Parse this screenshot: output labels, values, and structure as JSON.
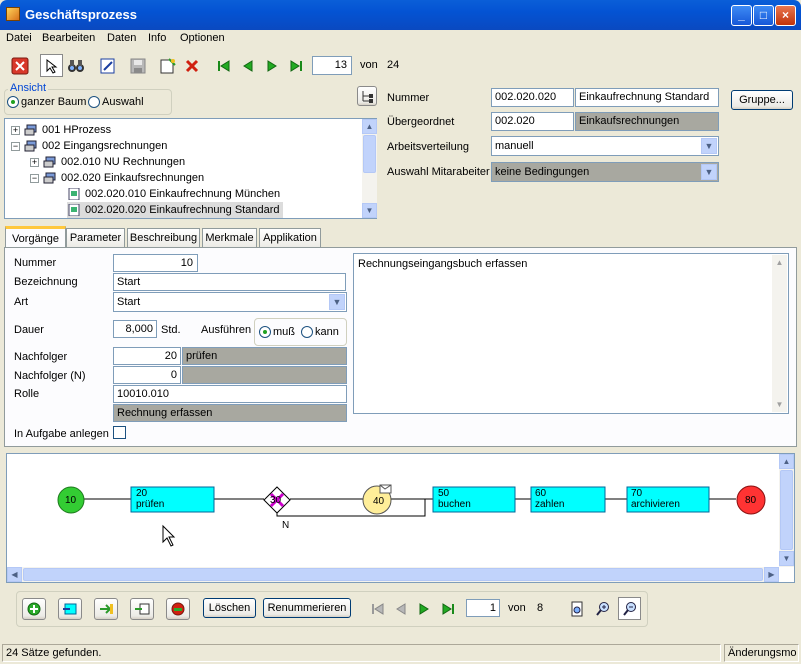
{
  "window": {
    "title": "Geschäftsprozess"
  },
  "menu": [
    "Datei",
    "Bearbeiten",
    "Daten",
    "Info",
    "Optionen"
  ],
  "toolbar": {
    "record_current": "13",
    "record_of_label": "von",
    "record_total": "24"
  },
  "view": {
    "group_label": "Ansicht",
    "option_tree": "ganzer Baum",
    "option_selection": "Auswahl"
  },
  "tree": {
    "items": [
      "001 HProzess",
      "002 Eingangsrechnungen",
      "002.010 NU Rechnungen",
      "002.020 Einkaufsrechnungen",
      "002.020.010 Einkaufrechnung München",
      "002.020.020 Einkaufrechnung Standard"
    ]
  },
  "header_form": {
    "nummer_label": "Nummer",
    "nummer_value": "002.020.020",
    "nummer_desc": "Einkaufrechnung Standard",
    "gruppe_button": "Gruppe...",
    "uebergeordnet_label": "Übergeordnet",
    "uebergeordnet_value": "002.020",
    "uebergeordnet_desc": "Einkaufsrechnungen",
    "arbeitsverteilung_label": "Arbeitsverteilung",
    "arbeitsverteilung_value": "manuell",
    "auswahl_label": "Auswahl Mitarabeiter",
    "auswahl_value": "keine Bedingungen"
  },
  "tabs": [
    "Vorgänge",
    "Parameter",
    "Beschreibung",
    "Merkmale",
    "Applikation"
  ],
  "vorgang": {
    "nummer_label": "Nummer",
    "nummer_value": "10",
    "bezeichnung_label": "Bezeichnung",
    "bezeichnung_value": "Start",
    "art_label": "Art",
    "art_value": "Start",
    "dauer_label": "Dauer",
    "dauer_value": "8,000",
    "dauer_unit": "Std.",
    "ausfuehren_label": "Ausführen",
    "ausfuehren_option1": "muß",
    "ausfuehren_option2": "kann",
    "nachfolger_label": "Nachfolger",
    "nachfolger_value": "20",
    "nachfolger_desc": "prüfen",
    "nachfolger_n_label": "Nachfolger (N)",
    "nachfolger_n_value": "0",
    "rolle_label": "Rolle",
    "rolle_value": "10010.010",
    "rolle_desc": "Rechnung erfassen",
    "aufgabe_label": "In Aufgabe anlegen",
    "description_text": "Rechnungseingangsbuch erfassen"
  },
  "diagram": {
    "nodes": [
      {
        "id": "10",
        "kind": "start"
      },
      {
        "id": "20",
        "label": "prüfen"
      },
      {
        "id": "30",
        "kind": "gateway"
      },
      {
        "id": "40",
        "kind": "event"
      },
      {
        "id": "50",
        "label": "buchen"
      },
      {
        "id": "60",
        "label": "zahlen"
      },
      {
        "id": "70",
        "label": "archivieren"
      },
      {
        "id": "80",
        "kind": "end"
      }
    ],
    "branch_label": "N"
  },
  "bottom_toolbar": {
    "delete_button": "Löschen",
    "renumber_button": "Renummerieren",
    "page_current": "1",
    "page_of_label": "von",
    "page_total": "8"
  },
  "status": {
    "left": "24 Sätze gefunden.",
    "right": "Änderungsmo"
  },
  "colors": {
    "task_fill": "#00ffff",
    "start_fill": "#33cc33",
    "end_fill": "#ff3333",
    "event_fill": "#ffee99",
    "gateway_mark": "#cc00cc"
  }
}
